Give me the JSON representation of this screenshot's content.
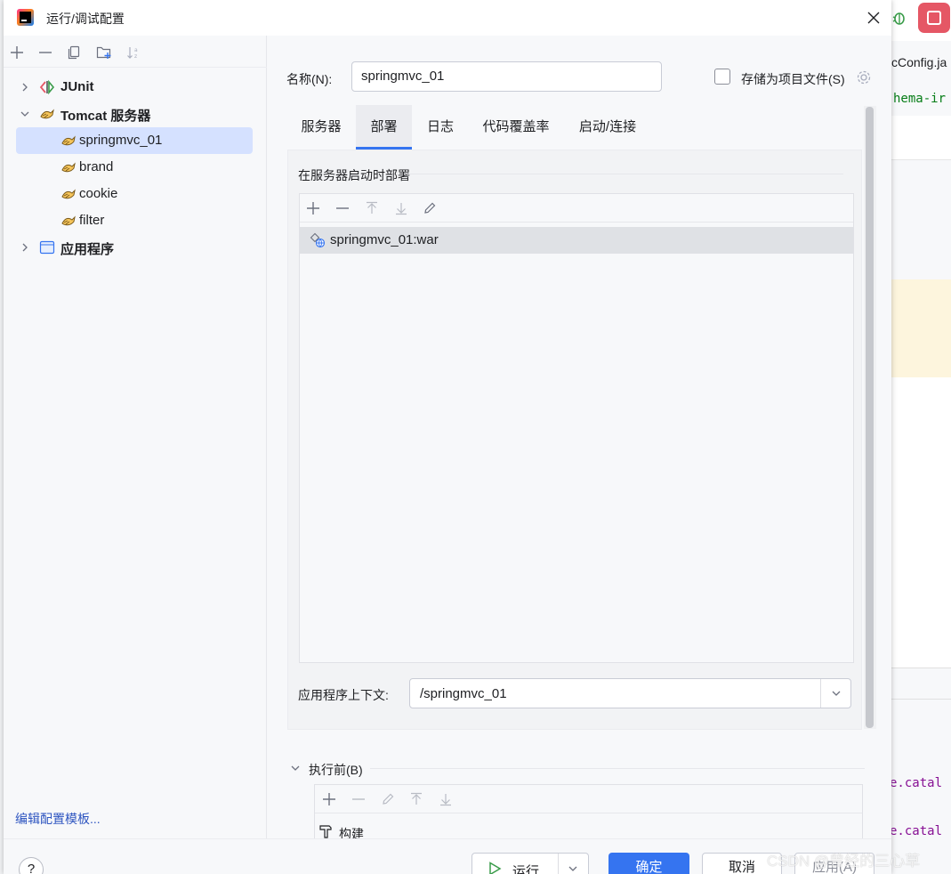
{
  "window": {
    "title": "运行/调试配置"
  },
  "background_ide": {
    "tab_text": "cConfig.ja",
    "code_line_1": "hema-ir",
    "code_line_2": "e.catal",
    "code_line_3": "e.catal"
  },
  "left_toolbar": {
    "icons": [
      "plus-icon",
      "minus-icon",
      "copy-icon",
      "folder-add-icon",
      "sort-icon"
    ]
  },
  "tree": {
    "junit": "JUnit",
    "tomcat": "Tomcat 服务器",
    "children": [
      "springmvc_01",
      "brand",
      "cookie",
      "filter"
    ],
    "application": "应用程序"
  },
  "edit_templates": "编辑配置模板...",
  "name": {
    "label": "名称(N):",
    "value": "springmvc_01"
  },
  "store_as_project_file": {
    "label": "存储为项目文件(S)",
    "checked": false
  },
  "tabs": [
    "服务器",
    "部署",
    "日志",
    "代码覆盖率",
    "启动/连接"
  ],
  "active_tab": "部署",
  "deploy": {
    "section_title": "在服务器启动时部署",
    "artifacts": [
      "springmvc_01:war"
    ],
    "context_label": "应用程序上下文:",
    "context_value": "/springmvc_01"
  },
  "before_launch": {
    "label": "执行前(B)",
    "tasks": [
      "构建"
    ]
  },
  "buttons": {
    "help": "?",
    "run": "运行",
    "ok": "确定",
    "cancel": "取消",
    "apply": "应用(A)"
  },
  "watermark": "CSDN @曾经的三心草",
  "colors": {
    "accent": "#3574f0",
    "selection": "#d5e1ff",
    "link": "#2e55c0"
  }
}
